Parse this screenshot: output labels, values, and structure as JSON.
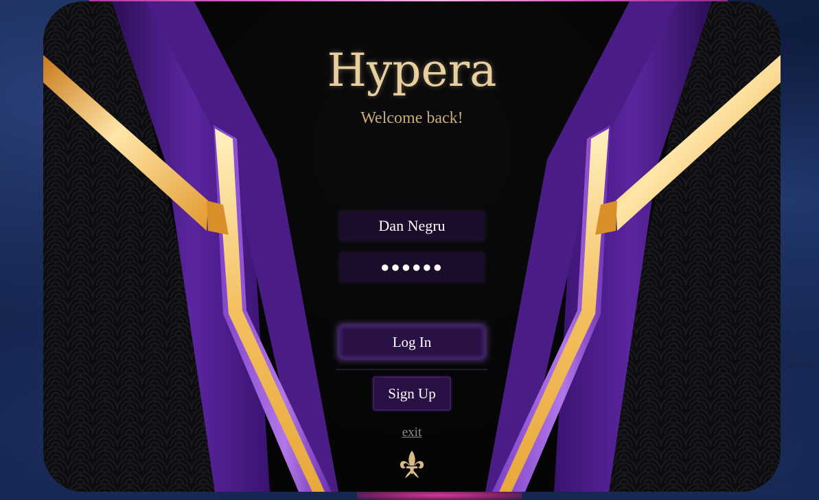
{
  "app": {
    "title": "Hypera",
    "subtitle": "Welcome back!"
  },
  "form": {
    "username_value": "Dan Negru",
    "password_value": "●●●●●●",
    "login_label": "Log In",
    "signup_label": "Sign Up",
    "exit_label": "exit"
  },
  "icons": {
    "emblem": "fleur-de-lis-icon"
  },
  "colors": {
    "title_gold": "#e8cfa0",
    "accent_purple": "#6a2fa8",
    "accent_gold": "#f0b548",
    "field_bg": "#1c0c2b"
  }
}
